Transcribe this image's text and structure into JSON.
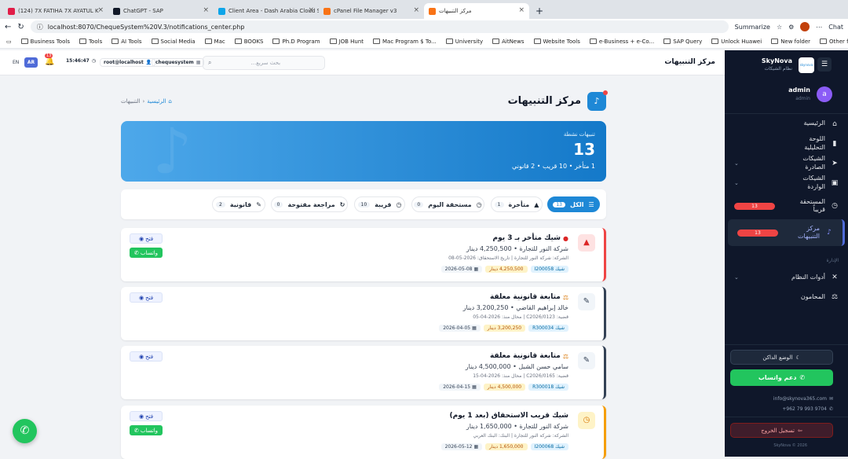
{
  "browser": {
    "tabs": [
      {
        "title": "(124) 7X FATIHA 7X AYATUL K",
        "color": "#e11d48"
      },
      {
        "title": "ChatGPT - SAP",
        "color": "#111827"
      },
      {
        "title": "Client Area - Dash Arabia Cloud S",
        "color": "#0ea5e9"
      },
      {
        "title": "cPanel File Manager v3",
        "color": "#f97316"
      },
      {
        "title": "مركز التنبيهات",
        "color": "#f97316"
      }
    ],
    "url": "localhost:8070/ChequeSystem%20V.3/notifications_center.php",
    "summarize": "Summarize",
    "chat": "Chat",
    "bookmarks": [
      "Business Tools",
      "Tools",
      "AI Tools",
      "Social Media",
      "Mac",
      "BOOKS",
      "Ph.D Program",
      "JOB Hunt",
      "Mac Program $ To...",
      "University",
      "AitNews",
      "Website Tools",
      "e-Business + e-Co...",
      "SAP Query",
      "Unlock Huawei",
      "New folder"
    ],
    "other_favorites": "Other favorites"
  },
  "sidebar": {
    "brand": "SkyNova",
    "brand_sub": "نظام الشيكات",
    "logo_text": "skynova",
    "user": {
      "name": "admin",
      "role": "admin",
      "initial": "a"
    },
    "items": [
      {
        "label": "الرئيسية",
        "icon": "home-icon",
        "glyph": "⌂"
      },
      {
        "label": "اللوحة التحليلية",
        "icon": "chart-icon",
        "glyph": "▮"
      },
      {
        "label": "الشيكات الصادرة",
        "icon": "send-icon",
        "glyph": "➤"
      },
      {
        "label": "الشيكات الواردة",
        "icon": "inbox-icon",
        "glyph": "▣"
      },
      {
        "label": "المستحقة قريباً",
        "icon": "clock-icon",
        "glyph": "◷",
        "badge": "13"
      },
      {
        "label": "مركز التنبيهات",
        "icon": "bell-icon",
        "glyph": "♪",
        "badge": "13"
      }
    ],
    "section": "الإدارة",
    "admin_items": [
      {
        "label": "أدوات النظام",
        "icon": "tools-icon",
        "glyph": "✕"
      },
      {
        "label": "المحامون",
        "icon": "scale-icon",
        "glyph": "⚖"
      }
    ],
    "dark_mode": "الوضع الداكن",
    "whatsapp": "دعم واتساب",
    "email": "info@skynova365.com",
    "phone": "9704 993 79 962+",
    "logout": "تسجيل الخروج",
    "copyright": "SkyNova © 2026"
  },
  "topbar": {
    "title": "مركز التنبيهات",
    "search_placeholder": "بحث سريع...",
    "db": "chequesystem",
    "user": "root@localhost",
    "time": "15:46:47",
    "bell_count": "13",
    "lang_ar": "AR",
    "lang_en": "EN"
  },
  "page": {
    "heading": "مركز التنبيهات",
    "breadcrumb_home": "الرئيسية",
    "breadcrumb_current": "التنبيهات",
    "banner": {
      "label": "تنبيهات نشطة",
      "count": "13",
      "summary": "1 متأخر • 10 قريب • 2 قانوني"
    },
    "filters": [
      {
        "label": "الكل",
        "count": "13",
        "glyph": "☰",
        "active": true
      },
      {
        "label": "متأخرة",
        "count": "1",
        "glyph": "▲"
      },
      {
        "label": "مستحقة اليوم",
        "count": "0",
        "glyph": "◷"
      },
      {
        "label": "قريبة",
        "count": "10",
        "glyph": "◷"
      },
      {
        "label": "مراجعة مفتوحة",
        "count": "0",
        "glyph": "↻"
      },
      {
        "label": "قانونية",
        "count": "2",
        "glyph": "✎"
      }
    ]
  },
  "notifications": [
    {
      "title": "شيك متأخر بـ 3 يوم",
      "line": "شركة النور للتجارة • 4,250,500 دينار",
      "meta": "الشركة: شركة النور للتجارة | تاريخ الاستحقاق: 2026-05-08",
      "ref": "شيك I200058",
      "amount": "4,250,500 دينار",
      "date": "2026-05-08",
      "accent": "#ef4444",
      "iconbg": "#fee2e2",
      "glyph": "▲",
      "iconcolor": "#dc2626",
      "mark": "●",
      "markcolor": "#dc2626",
      "open": "فتح",
      "wa": "واتساب"
    },
    {
      "title": "متابعة قانونية معلقة",
      "line": "خالد إبراهيم القاضي • 3,200,250 دينار",
      "meta": "قضية: C2026/0123 | محال منذ: 2026-04-05",
      "ref": "شيك R300034",
      "amount": "3,200,250 دينار",
      "date": "2026-04-05",
      "accent": "#334155",
      "iconbg": "#f1f5f9",
      "glyph": "✎",
      "iconcolor": "#334155",
      "mark": "⚖",
      "markcolor": "#d97706",
      "open": "فتح"
    },
    {
      "title": "متابعة قانونية معلقة",
      "line": "سامي حسن الشبل • 4,500,000 دينار",
      "meta": "قضية: C2026/0165 | محال منذ: 2026-04-15",
      "ref": "شيك R300018",
      "amount": "4,500,000 دينار",
      "date": "2026-04-15",
      "accent": "#334155",
      "iconbg": "#f1f5f9",
      "glyph": "✎",
      "iconcolor": "#334155",
      "mark": "⚖",
      "markcolor": "#d97706",
      "open": "فتح"
    },
    {
      "title": "شيك قريب الاستحقاق (بعد 1 يوم)",
      "line": "شركة النور للتجارة • 1,650,000 دينار",
      "meta": "الشركة: شركة النور للتجارة | البنك: البنك العربي",
      "ref": "شيك I200068",
      "amount": "1,650,000 دينار",
      "date": "2026-05-12",
      "accent": "#f59e0b",
      "iconbg": "#fef3c7",
      "glyph": "◷",
      "iconcolor": "#d97706",
      "mark": "",
      "markcolor": "#d97706",
      "open": "فتح",
      "wa": "واتساب"
    }
  ],
  "colors": {
    "primary": "#1e88d6",
    "sidebar": "#0f172a",
    "whatsapp": "#22c55e",
    "danger": "#ef4444"
  }
}
